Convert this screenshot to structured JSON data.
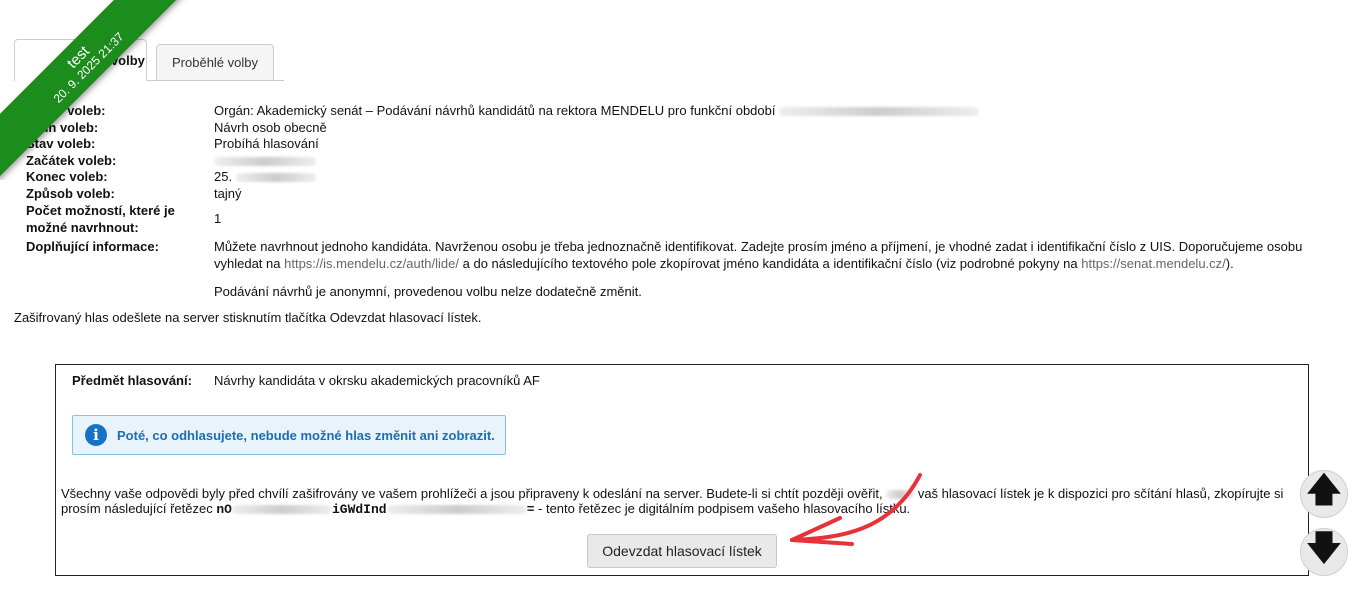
{
  "ribbon": {
    "line1": "test",
    "line2": "20. 9. 2025 21:37"
  },
  "tabs": [
    {
      "label": "Aktuální volby"
    },
    {
      "label": "Proběhlé volby"
    }
  ],
  "election": {
    "name_label": "Název voleb:",
    "name_value": "Orgán: Akademický senát – Podávání návrhů kandidátů na rektora MENDELU pro funkční období",
    "type_label": "Druh voleb:",
    "type_value": "Návrh osob obecně",
    "state_label": "Stav voleb:",
    "state_value": "Probíhá hlasování",
    "start_label": "Začátek voleb:",
    "end_label": "Konec voleb:",
    "end_value_prefix": "25.",
    "method_label": "Způsob voleb:",
    "method_value": "tajný",
    "options_label": "Počet možností, které je možné navrhnout:",
    "options_value": "1",
    "extra_label": "Doplňující informace:",
    "extra_p1_a": "Můžete navrhnout jednoho kandidáta. Navrženou osobu je třeba jednoznačně identifikovat. Zadejte prosím jméno a příjmení, je vhodné zadat i identifikační číslo z UIS. Doporučujeme osobu vyhledat na",
    "extra_link1": "https://is.mendelu.cz/auth/lide/",
    "extra_p1_b": "a do následujícího textového pole zkopírovat jméno kandidáta a identifikační číslo (viz podrobné pokyny na",
    "extra_link2": "https://senat.mendelu.cz/",
    "extra_p1_c": ").",
    "extra_p2": "Podávání návrhů je anonymní, provedenou volbu nelze dodatečně změnit."
  },
  "note": "Zašifrovaný hlas odešlete na server stisknutím tlačítka Odevzdat hlasovací lístek.",
  "ballot": {
    "subject_label": "Předmět hlasování:",
    "subject_value": "Návrhy kandidáta v okrsku akademických pracovníků AF",
    "alert_icon": "info-icon",
    "alert_text": "Poté, co odhlasujete, nebude možné hlas změnit ani zobrazit.",
    "expl_a": "Všechny vaše odpovědi byly před chvílí zašifrovány ve vašem prohlížeči a jsou připraveny k odeslání na server. Budete-li si chtít později ověřit,",
    "expl_b": "vaš hlasovací lístek je k dispozici pro sčítání hlasů, zkopírujte si prosím následující řetězec",
    "hash_a": "nO",
    "hash_b": "iGWdInd",
    "hash_c": "=",
    "expl_c": "- tento řetězec je digitálním podpisem vašeho hlasovacího lístku.",
    "submit_label": "Odevzdat hlasovací lístek"
  },
  "scroll": {
    "up_icon": "arrow-up-icon",
    "down_icon": "arrow-down-icon",
    "up_glyph": "🡅",
    "down_glyph": "🡇"
  },
  "colors": {
    "ribbon": "#1c8c1c",
    "alert_bg": "#e8f3fb",
    "alert_text": "#1b6fb0",
    "annotation": "#e8323a"
  }
}
